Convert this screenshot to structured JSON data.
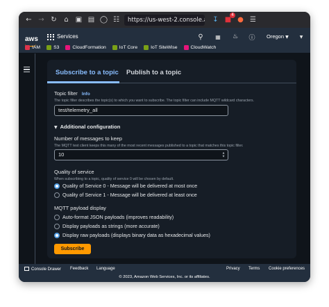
{
  "browser": {
    "url": "https://us-west-2.console.aws",
    "icons": [
      "back-icon",
      "forward-icon",
      "reload-icon",
      "home-icon",
      "tab-icon",
      "picture-icon",
      "shield-icon",
      "container-icon",
      "download-icon",
      "extension-icon",
      "sync-icon",
      "menu-icon"
    ],
    "badge_count": "4"
  },
  "aws_nav": {
    "logo_text": "aws",
    "services_label": "Services",
    "region": "Oregon",
    "icons": [
      "search-icon",
      "cloudshell-icon",
      "bell-icon",
      "help-icon",
      "settings-icon",
      "account-caret-icon"
    ]
  },
  "favorites": [
    {
      "label": "IAM",
      "color": "#dd344c"
    },
    {
      "label": "S3",
      "color": "#7aa116"
    },
    {
      "label": "CloudFormation",
      "color": "#e7157b"
    },
    {
      "label": "IoT Core",
      "color": "#7aa116"
    },
    {
      "label": "IoT SiteWise",
      "color": "#7aa116"
    },
    {
      "label": "CloudWatch",
      "color": "#e7157b"
    }
  ],
  "tabs": {
    "subscribe": "Subscribe to a topic",
    "publish": "Publish to a topic"
  },
  "form": {
    "topic_filter_label": "Topic filter",
    "info_label": "Info",
    "topic_filter_desc": "The topic filter describes the topic(s) to which you want to subscribe. The topic filter can include MQTT wildcard characters.",
    "topic_filter_value": "test/telemetry_all",
    "additional_config": "Additional configuration",
    "messages_label": "Number of messages to keep",
    "messages_desc": "The MQTT test client keeps this many of the most recent messages published to a topic that matches this topic filter.",
    "messages_value": "10",
    "qos_label": "Quality of service",
    "qos_desc": "When subscribing to a topic, quality of service 0 will be chosen by default.",
    "qos_options": [
      "Quality of Service 0 - Message will be delivered at most once",
      "Quality of Service 1 - Message will be delivered at least once"
    ],
    "payload_label": "MQTT payload display",
    "payload_options": [
      "Auto-format JSON payloads (improves readability)",
      "Display payloads as strings (more accurate)",
      "Display raw payloads (displays binary data as hexadecimal values)"
    ],
    "subscribe_button": "Subscribe"
  },
  "footer": {
    "console_drawer": "Console Drawer",
    "feedback": "Feedback",
    "language": "Language",
    "privacy": "Privacy",
    "terms": "Terms",
    "cookie": "Cookie preferences",
    "copyright": "© 2023, Amazon Web Services, Inc. or its affiliates."
  }
}
